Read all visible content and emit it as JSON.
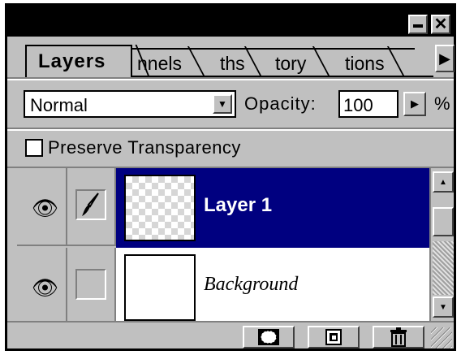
{
  "titlebar": {
    "minimize_icon": "minimize-icon",
    "close_icon": "close-icon"
  },
  "tabs": [
    {
      "label": "Layers",
      "active": true
    },
    {
      "label": "nnels",
      "active": false
    },
    {
      "label": "ths",
      "active": false
    },
    {
      "label": "tory",
      "active": false
    },
    {
      "label": "tions",
      "active": false
    }
  ],
  "controls": {
    "blend_mode": "Normal",
    "opacity_label": "Opacity:",
    "opacity_value": "100",
    "opacity_unit": "%"
  },
  "preserve": {
    "label": "Preserve Transparency",
    "checked": false
  },
  "layers": [
    {
      "name": "Layer 1",
      "visible": true,
      "brush": true,
      "selected": true
    },
    {
      "name": "Background",
      "visible": true,
      "brush": false,
      "selected": false
    }
  ],
  "colors": {
    "selected": "#000080",
    "panel": "#c0c0c0"
  }
}
